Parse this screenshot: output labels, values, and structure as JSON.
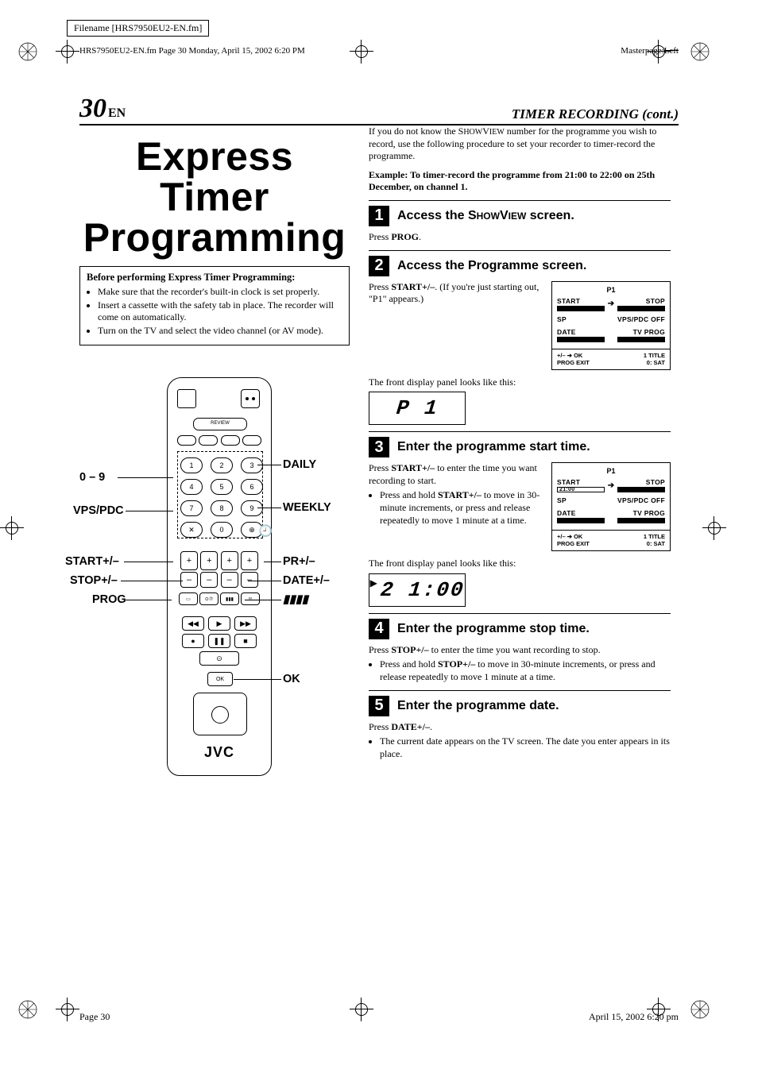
{
  "meta": {
    "filename": "Filename [HRS7950EU2-EN.fm]",
    "header_left": "HRS7950EU2-EN.fm  Page 30  Monday, April 15, 2002  6:20 PM",
    "masterpage_label": "Masterpage:",
    "masterpage_value": "Left",
    "footer_page": "Page 30",
    "footer_date": "April 15, 2002 6:20 pm"
  },
  "page": {
    "number": "30",
    "lang": "EN",
    "section": "TIMER RECORDING (cont.)",
    "title": "Express Timer Programming"
  },
  "before": {
    "heading": "Before performing Express Timer Programming:",
    "items": [
      "Make sure that the recorder's built-in clock is set properly.",
      "Insert a cassette with the safety tab in place. The recorder will come on automatically.",
      "Turn on the TV and select the video channel (or AV mode)."
    ]
  },
  "remote": {
    "labels": {
      "digits": "0 – 9",
      "vpspdc": "VPS/PDC",
      "start": "START+/–",
      "stop": "STOP+/–",
      "prog": "PROG",
      "daily": "DAILY",
      "weekly": "WEEKLY",
      "pr": "PR+/–",
      "date": "DATE+/–",
      "jvcbars": "▮▮▮▮",
      "ok": "OK"
    },
    "brand": "JVC",
    "review": "REVIEW",
    "keys": [
      "1",
      "2",
      "3",
      "4",
      "5",
      "6",
      "7",
      "8",
      "9",
      "✕",
      "0",
      "⊕"
    ],
    "clockglyph": "🕘"
  },
  "right": {
    "intro": "If you do not know the SHOWVIEW number for the programme you wish to record, use the following procedure to set your recorder to timer-record the programme.",
    "example": "Example: To timer-record the programme from 21:00 to 22:00 on 25th December, on channel 1.",
    "front_caption": "The front display panel looks like this:"
  },
  "steps": {
    "s1": {
      "num": "1",
      "title_a": "Access the ",
      "title_sc": "SHOWVIEW",
      "title_b": " screen.",
      "body_prefix": "Press ",
      "body_btn": "PROG",
      "body_suffix": "."
    },
    "s2": {
      "num": "2",
      "title": "Access the Programme screen.",
      "body_prefix": "Press ",
      "body_btn": "START+/–",
      "body_suffix": ". (If you're just starting out, \"P1\" appears.)"
    },
    "s3": {
      "num": "3",
      "title": "Enter the programme start time.",
      "body_prefix": "Press ",
      "body_btn": "START+/–",
      "body_suffix": " to enter the time you want recording to start.",
      "bullet_a": "Press and hold ",
      "bullet_btn": "START+/–",
      "bullet_b": " to move in 30-minute increments, or press and release repeatedly to move 1 minute at a time."
    },
    "s4": {
      "num": "4",
      "title": "Enter the programme stop time.",
      "body_prefix": "Press ",
      "body_btn": "STOP+/–",
      "body_suffix": " to enter the time you want recording to stop.",
      "bullet_a": "Press and hold ",
      "bullet_btn": "STOP+/–",
      "bullet_b": " to move in 30-minute increments, or press and release repeatedly to move 1 minute at a time."
    },
    "s5": {
      "num": "5",
      "title": "Enter the programme date.",
      "body_prefix": "Press ",
      "body_btn": "DATE+/–",
      "body_suffix": ".",
      "bullet": "The current date appears on the TV screen. The date you enter appears in its place."
    }
  },
  "osd": {
    "p1": "P1",
    "start": "START",
    "stop": "STOP",
    "sp": "SP",
    "vpspdc_off": "VPS/PDC OFF",
    "date": "DATE",
    "tvprog": "TV PROG",
    "foot_left": "+/– ➔ OK\nPROG EXIT",
    "foot_right": "1 TITLE\n0:  SAT",
    "start_val": "21:00",
    "stop_val": "– – : – –"
  },
  "seg": {
    "p1": "P 1",
    "t2100": "2 1:00"
  }
}
